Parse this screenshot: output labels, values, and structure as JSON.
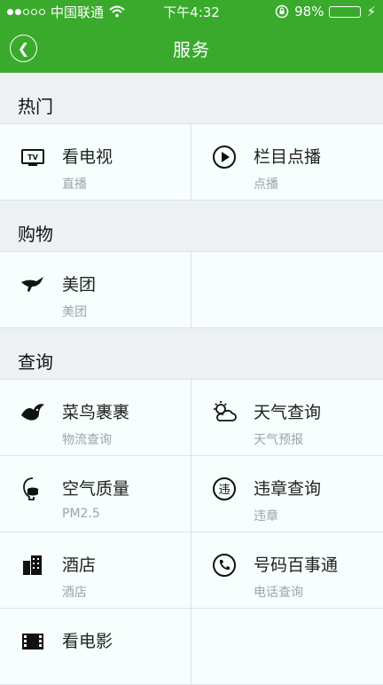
{
  "status": {
    "carrier": "中国联通",
    "time": "下午4:32",
    "battery": "98%",
    "battery_level": 0.98
  },
  "navbar": {
    "title": "服务"
  },
  "sections": [
    {
      "title": "热门",
      "items": [
        {
          "name": "看电视",
          "sub": "直播",
          "icon": "tv-icon"
        },
        {
          "name": "栏目点播",
          "sub": "点播",
          "icon": "play-circle-icon"
        }
      ]
    },
    {
      "title": "购物",
      "items": [
        {
          "name": "美团",
          "sub": "美团",
          "icon": "kangaroo-icon"
        }
      ]
    },
    {
      "title": "查询",
      "items": [
        {
          "name": "菜鸟裹裹",
          "sub": "物流查询",
          "icon": "bird-icon"
        },
        {
          "name": "天气查询",
          "sub": "天气预报",
          "icon": "weather-icon"
        },
        {
          "name": "空气质量",
          "sub": "PM2.5",
          "icon": "mask-icon"
        },
        {
          "name": "违章查询",
          "sub": "违章",
          "icon": "violation-icon"
        },
        {
          "name": "酒店",
          "sub": "酒店",
          "icon": "hotel-icon"
        },
        {
          "name": "号码百事通",
          "sub": "电话查询",
          "icon": "phone-icon"
        },
        {
          "name": "看电影",
          "sub": "",
          "icon": "film-icon"
        }
      ]
    }
  ]
}
